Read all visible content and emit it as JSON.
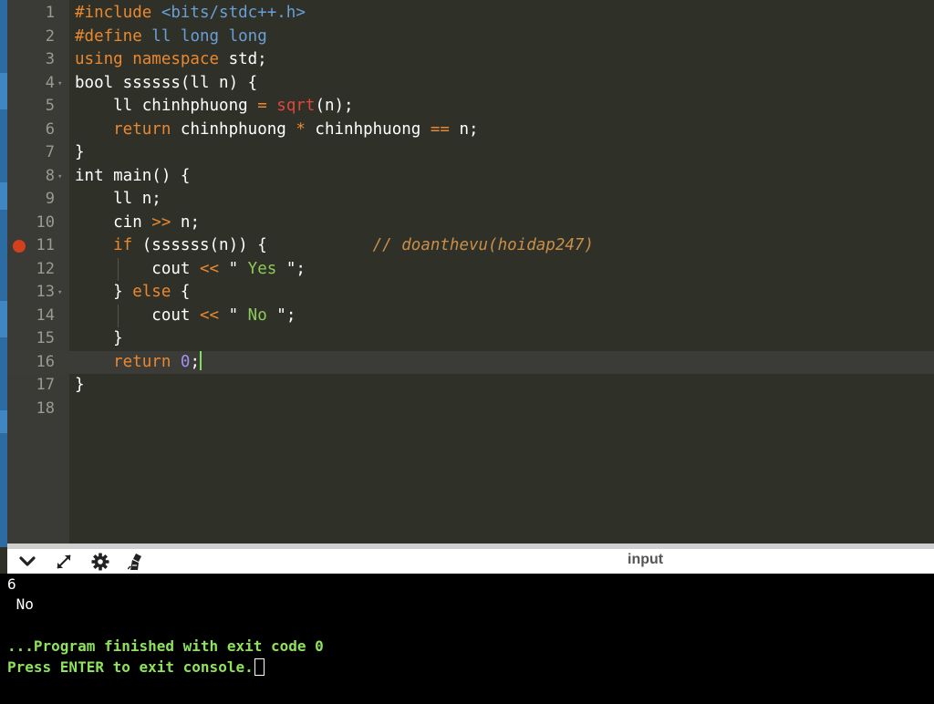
{
  "editor": {
    "lines": [
      {
        "n": "1",
        "fold": false,
        "bp": false,
        "tokens": [
          [
            "pp",
            "#include "
          ],
          [
            "inc",
            "<bits/stdc++.h>"
          ]
        ]
      },
      {
        "n": "2",
        "fold": false,
        "bp": false,
        "tokens": [
          [
            "pp",
            "#define "
          ],
          [
            "ty",
            "ll long long"
          ]
        ]
      },
      {
        "n": "3",
        "fold": false,
        "bp": false,
        "tokens": [
          [
            "kw",
            "using "
          ],
          [
            "kw",
            "namespace "
          ],
          [
            "",
            "std;"
          ]
        ]
      },
      {
        "n": "4",
        "fold": true,
        "bp": false,
        "tokens": [
          [
            "",
            "bool ssssss(ll n) {"
          ]
        ]
      },
      {
        "n": "5",
        "fold": false,
        "bp": false,
        "tokens": [
          [
            "",
            "    ll chinhphuong "
          ],
          [
            "op",
            "="
          ],
          [
            "",
            " "
          ],
          [
            "fn",
            "sqrt"
          ],
          [
            "",
            "(n);"
          ]
        ]
      },
      {
        "n": "6",
        "fold": false,
        "bp": false,
        "tokens": [
          [
            "kw",
            "    return "
          ],
          [
            "",
            "chinhphuong "
          ],
          [
            "op",
            "*"
          ],
          [
            "",
            " chinhphuong "
          ],
          [
            "op",
            "=="
          ],
          [
            "",
            " n;"
          ]
        ]
      },
      {
        "n": "7",
        "fold": false,
        "bp": false,
        "tokens": [
          [
            "",
            "}"
          ]
        ]
      },
      {
        "n": "8",
        "fold": true,
        "bp": false,
        "tokens": [
          [
            "",
            "int main() {"
          ]
        ]
      },
      {
        "n": "9",
        "fold": false,
        "bp": false,
        "tokens": [
          [
            "",
            "    ll n;"
          ]
        ]
      },
      {
        "n": "10",
        "fold": false,
        "bp": false,
        "tokens": [
          [
            "",
            "    cin "
          ],
          [
            "op",
            ">>"
          ],
          [
            "",
            " n;"
          ]
        ]
      },
      {
        "n": "11",
        "fold": false,
        "bp": true,
        "tokens": [
          [
            "kw",
            "    if "
          ],
          [
            "",
            "(ssssss(n)) {           "
          ],
          [
            "cm",
            "// doanthevu(hoidap247)"
          ]
        ]
      },
      {
        "n": "12",
        "fold": false,
        "bp": false,
        "tokens": [
          [
            "",
            "        cout "
          ],
          [
            "op",
            "<<"
          ],
          [
            "",
            " \""
          ],
          [
            "str",
            " Yes "
          ],
          [
            "",
            "\";"
          ]
        ]
      },
      {
        "n": "13",
        "fold": true,
        "bp": false,
        "tokens": [
          [
            "",
            "    } "
          ],
          [
            "kw",
            "else"
          ],
          [
            "",
            " {"
          ]
        ]
      },
      {
        "n": "14",
        "fold": false,
        "bp": false,
        "tokens": [
          [
            "",
            "        cout "
          ],
          [
            "op",
            "<<"
          ],
          [
            "",
            " \""
          ],
          [
            "str",
            " No "
          ],
          [
            "",
            "\";"
          ]
        ]
      },
      {
        "n": "15",
        "fold": false,
        "bp": false,
        "tokens": [
          [
            "",
            "    }"
          ]
        ]
      },
      {
        "n": "16",
        "fold": false,
        "bp": false,
        "active": true,
        "tokens": [
          [
            "kw",
            "    return "
          ],
          [
            "num",
            "0"
          ],
          [
            "",
            ";"
          ]
        ]
      },
      {
        "n": "17",
        "fold": false,
        "bp": false,
        "tokens": [
          [
            "",
            "}"
          ]
        ]
      },
      {
        "n": "18",
        "fold": false,
        "bp": false,
        "tokens": []
      }
    ]
  },
  "toolbar": {
    "title": "input",
    "icons": [
      "chevron-down-icon",
      "expand-icon",
      "gear-icon",
      "clear-console-icon"
    ]
  },
  "console": {
    "input_line": "6",
    "output_line": " No",
    "finish_line": "...Program finished with exit code 0",
    "press_line": "Press ENTER to exit console."
  },
  "colors": {
    "editor_bg": "#2f3129",
    "keyword": "#e98830",
    "string": "#8ec95b",
    "number": "#a58ff0",
    "console_green": "#8fe35c"
  }
}
